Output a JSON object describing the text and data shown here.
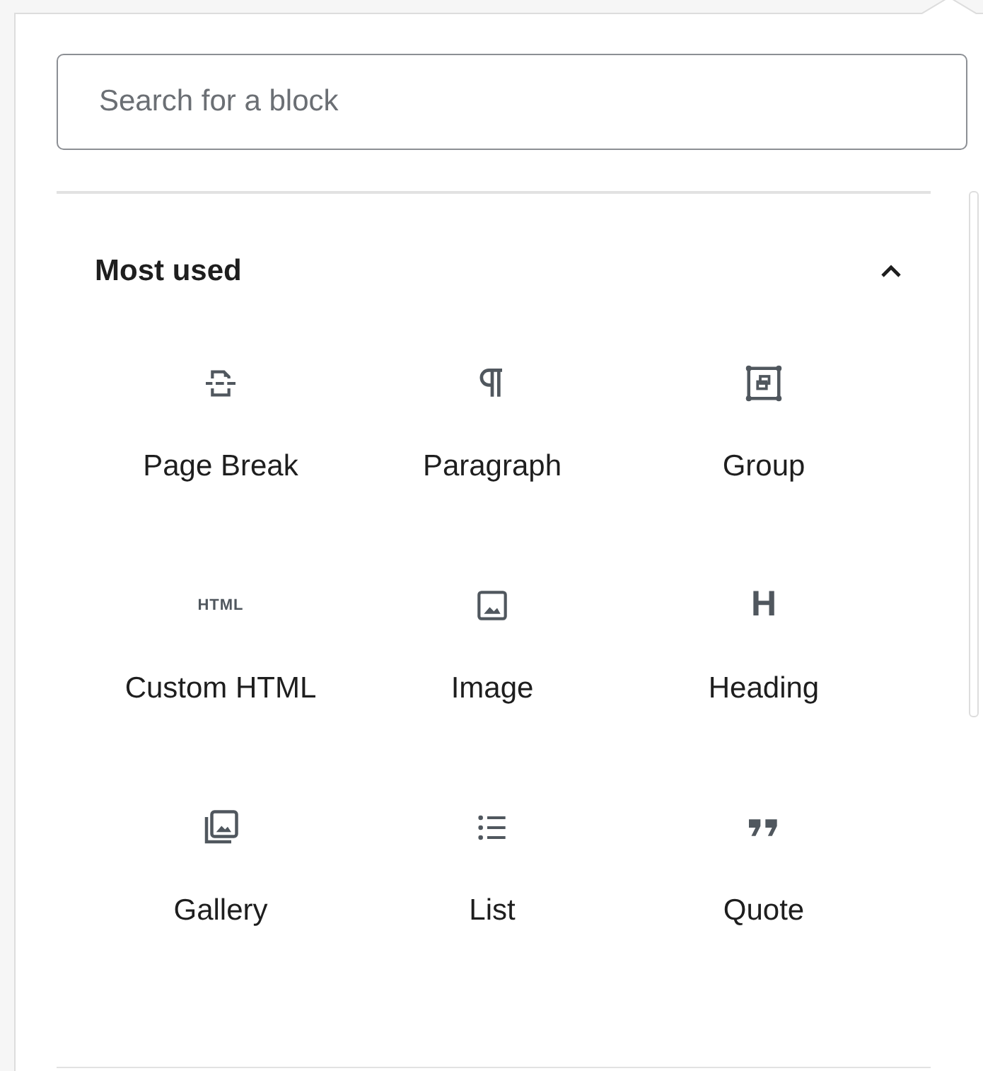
{
  "search": {
    "placeholder": "Search for a block"
  },
  "panel": {
    "title": "Most used",
    "expanded": true
  },
  "blocks": [
    {
      "label": "Page Break",
      "kind": "page-break"
    },
    {
      "label": "Paragraph",
      "kind": "paragraph"
    },
    {
      "label": "Group",
      "kind": "group"
    },
    {
      "label": "Custom HTML",
      "kind": "html",
      "icon_label": "HTML"
    },
    {
      "label": "Image",
      "kind": "image"
    },
    {
      "label": "Heading",
      "kind": "heading",
      "icon_label": "H"
    },
    {
      "label": "Gallery",
      "kind": "gallery"
    },
    {
      "label": "List",
      "kind": "list"
    },
    {
      "label": "Quote",
      "kind": "quote"
    }
  ]
}
